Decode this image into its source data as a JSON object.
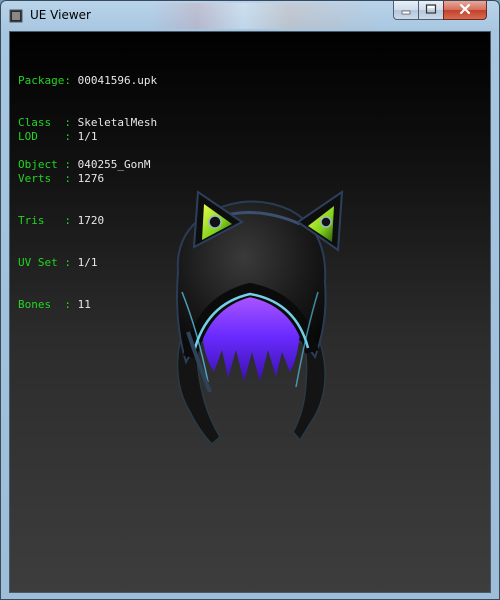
{
  "window": {
    "title": "UE Viewer"
  },
  "info": {
    "asset": [
      {
        "label": "Package",
        "value": "00041596.upk"
      },
      {
        "label": "Class  ",
        "value": "SkeletalMesh"
      },
      {
        "label": "Object ",
        "value": "040255_GonM"
      }
    ],
    "stats": [
      {
        "label": "LOD    ",
        "value": "1/1"
      },
      {
        "label": "Verts  ",
        "value": "1276"
      },
      {
        "label": "Tris   ",
        "value": "1720"
      },
      {
        "label": "UV Set ",
        "value": "1/1"
      },
      {
        "label": "Bones  ",
        "value": "11"
      }
    ]
  },
  "colors": {
    "label_green": "#22d522",
    "value_white": "#e8e8e8",
    "viewport_top": "#000000",
    "viewport_bottom": "#3d3d3d"
  },
  "icons": {
    "minimize": "minimize-icon",
    "maximize": "maximize-icon",
    "close": "close-icon",
    "app": "app-icon"
  }
}
